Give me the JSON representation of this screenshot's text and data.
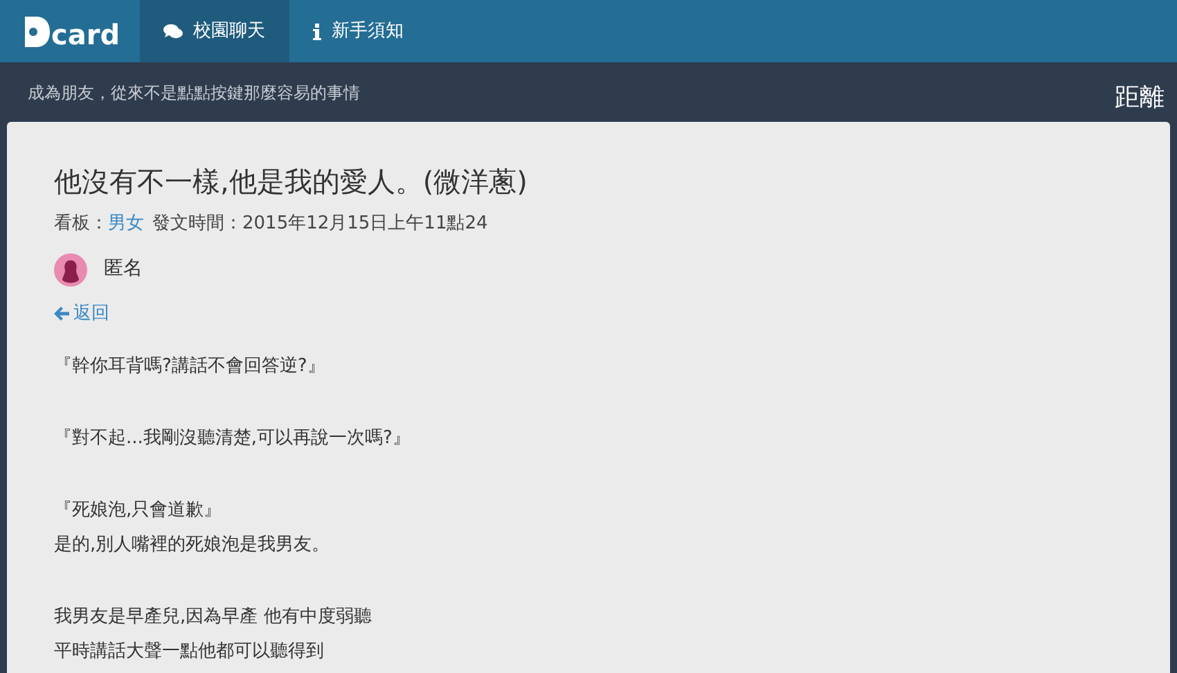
{
  "navbar": {
    "logo": "card",
    "tabs": [
      {
        "label": "校園聊天",
        "kind": "chat",
        "selected": true
      },
      {
        "label": "新手須知",
        "kind": "info",
        "selected": false
      }
    ]
  },
  "subheader": {
    "tagline": "成為朋友，從來不是點點按鍵那麼容易的事情",
    "right_text": "距離"
  },
  "post": {
    "title": "他沒有不一樣,他是我的愛人。(微洋蔥)",
    "board_label": "看板：",
    "board": "男女",
    "time_label": "發文時間：2015年12月15日上午11點24",
    "author": "匿名",
    "back": "返回",
    "paragraphs": [
      [
        "『幹你耳背嗎?講話不會回答逆?』"
      ],
      [
        "『對不起...我剛沒聽清楚,可以再說一次嗎?』"
      ],
      [
        "『死娘泡,只會道歉』",
        "是的,別人嘴裡的死娘泡是我男友。"
      ],
      [
        "我男友是早產兒,因為早產 他有中度弱聽",
        "平時講話大聲一點他都可以聽得到"
      ]
    ]
  }
}
